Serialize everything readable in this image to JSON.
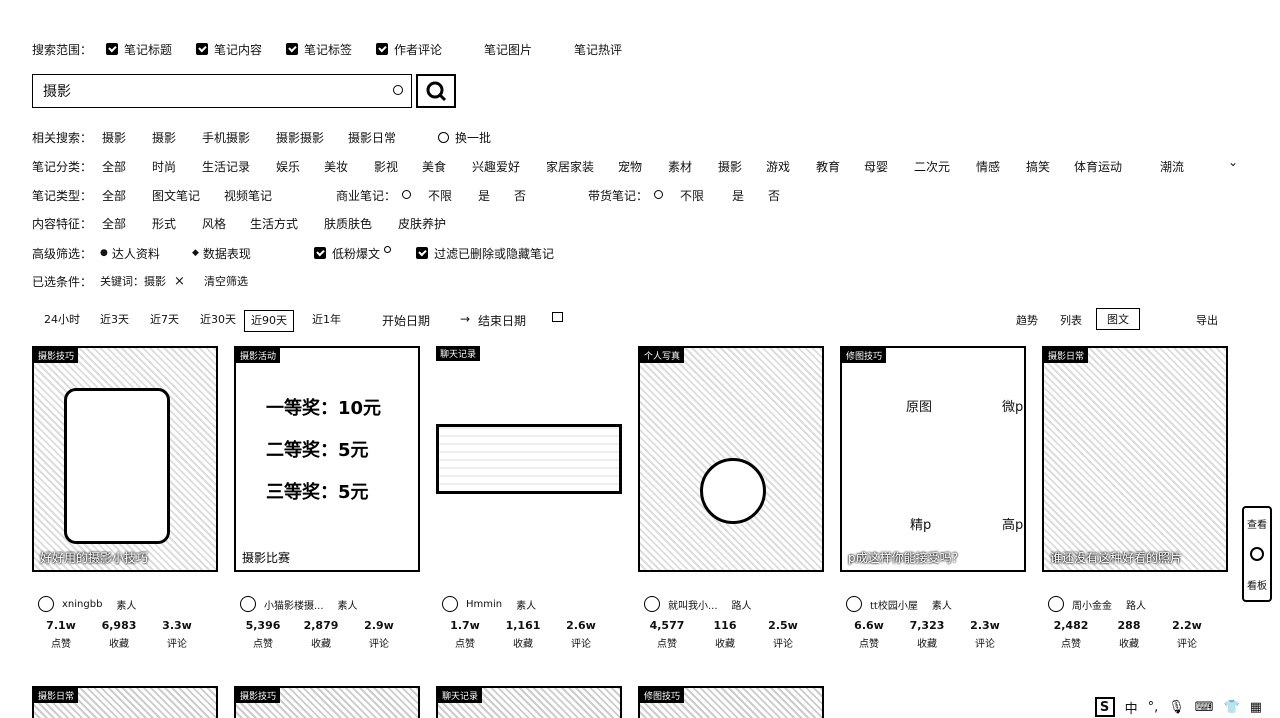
{
  "scope": {
    "label": "搜索范围：",
    "options": [
      {
        "label": "笔记标题",
        "checked": true
      },
      {
        "label": "笔记内容",
        "checked": true
      },
      {
        "label": "笔记标签",
        "checked": true
      },
      {
        "label": "作者评论",
        "checked": true
      },
      {
        "label": "笔记图片",
        "checked": false
      },
      {
        "label": "笔记热评",
        "checked": false
      }
    ]
  },
  "search": {
    "value": "摄影"
  },
  "related": {
    "label": "相关搜索：",
    "items": [
      "摄影",
      "摄影",
      "手机摄影",
      "摄影摄影",
      "摄影日常"
    ],
    "refresh": "换一批"
  },
  "category": {
    "label": "笔记分类：",
    "items": [
      "全部",
      "时尚",
      "生活记录",
      "娱乐",
      "美妆",
      "影视",
      "美食",
      "兴趣爱好",
      "家居家装",
      "宠物",
      "素材",
      "摄影",
      "游戏",
      "教育",
      "母婴",
      "二次元",
      "情感",
      "搞笑",
      "体育运动",
      "潮流"
    ]
  },
  "type": {
    "label": "笔记类型：",
    "items": [
      "全部",
      "图文笔记",
      "视频笔记"
    ],
    "commercial": {
      "label": "商业笔记：",
      "items": [
        "不限",
        "是",
        "否"
      ]
    },
    "goods": {
      "label": "带货笔记：",
      "items": [
        "不限",
        "是",
        "否"
      ]
    }
  },
  "feature": {
    "label": "内容特征：",
    "items": [
      "全部",
      "形式",
      "风格",
      "生活方式",
      "肤质肤色",
      "皮肤养护"
    ]
  },
  "advanced": {
    "label": "高级筛选：",
    "talent": "达人资料",
    "data": "数据表现",
    "low_fans": "低粉爆文",
    "filter_deleted": "过滤已删除或隐藏笔记"
  },
  "selected": {
    "label": "已选条件：",
    "keyword": "关键词：摄影",
    "clear": "清空筛选"
  },
  "time_tabs": [
    "24小时",
    "近3天",
    "近7天",
    "近30天",
    "近90天",
    "近1年"
  ],
  "time_active": "近90天",
  "date_range": {
    "start": "开始日期",
    "arrow": "→",
    "end": "结束日期"
  },
  "view": {
    "trend": "趋势",
    "list": "列表",
    "grid": "图文",
    "export": "导出"
  },
  "cards": [
    {
      "tag": "摄影技巧",
      "caption": "好好用的摄影小技巧",
      "author": "xningbb",
      "role": "素人",
      "likes": "7.1w",
      "collects": "6,983",
      "comments": "3.3w"
    },
    {
      "tag": "摄影活动",
      "caption": "摄影比赛",
      "author": "小猫影楼摄...",
      "role": "素人",
      "likes": "5,396",
      "collects": "2,879",
      "comments": "2.9w",
      "lines": [
        "一等奖：10元",
        "二等奖：5元",
        "三等奖：5元"
      ]
    },
    {
      "tag": "聊天记录",
      "caption": "",
      "author": "Hmmin",
      "role": "素人",
      "likes": "1.7w",
      "collects": "1,161",
      "comments": "2.6w"
    },
    {
      "tag": "个人写真",
      "caption": "",
      "author": "就叫我小...",
      "role": "路人",
      "likes": "4,577",
      "collects": "116",
      "comments": "2.5w"
    },
    {
      "tag": "修图技巧",
      "caption": "p成这样你能接受吗？",
      "author": "tt校园小屋",
      "role": "素人",
      "likes": "6.6w",
      "collects": "7,323",
      "comments": "2.3w",
      "labels": [
        "原图",
        "微p",
        "精p",
        "高p"
      ]
    },
    {
      "tag": "摄影日常",
      "caption": "谁还没有这种好看的照片",
      "author": "周小金金",
      "role": "路人",
      "likes": "2,482",
      "collects": "288",
      "comments": "2.2w"
    }
  ],
  "stat_labels": {
    "likes": "点赞",
    "collects": "收藏",
    "comments": "评论"
  },
  "bottom_tags": [
    "摄影日常",
    "摄影技巧",
    "聊天记录",
    "修图技巧"
  ],
  "side_tools": [
    "查看",
    "看板"
  ],
  "ime": {
    "brand": "S",
    "lang": "中"
  }
}
